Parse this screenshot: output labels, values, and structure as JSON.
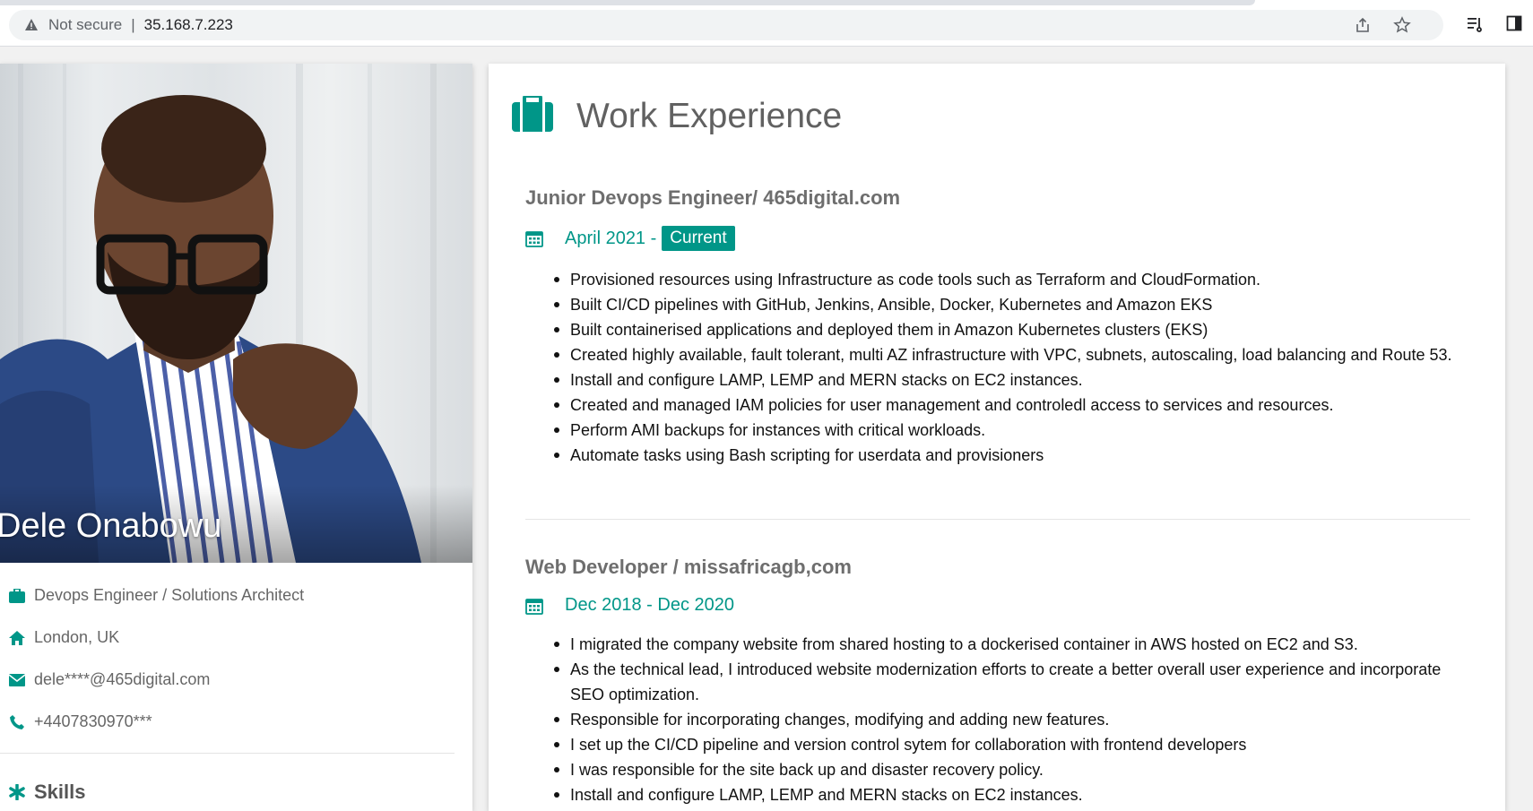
{
  "browser": {
    "security_label": "Not secure",
    "url": "35.168.7.223",
    "icons": [
      "warning-icon",
      "share-icon",
      "star-icon",
      "reading-list-icon",
      "side-panel-icon"
    ]
  },
  "profile": {
    "name": "Dele Onabowu",
    "photo_alt": "profile photo",
    "info": [
      {
        "icon": "briefcase-icon",
        "text": "Devops Engineer / Solutions Architect"
      },
      {
        "icon": "home-icon",
        "text": "London, UK"
      },
      {
        "icon": "envelope-icon",
        "text": "dele****@465digital.com"
      },
      {
        "icon": "phone-icon",
        "text": "+4407830970***"
      }
    ],
    "skills_heading": "Skills"
  },
  "work": {
    "heading": "Work Experience",
    "jobs": [
      {
        "title": "Junior Devops Engineer/ 465digital.com",
        "date": "April 2021 - ",
        "badge": "Current",
        "bullets": [
          "Provisioned resources using Infrastructure as code tools such as Terraform and CloudFormation.",
          "Built CI/CD pipelines with GitHub, Jenkins, Ansible, Docker, Kubernetes and Amazon EKS",
          "Built containerised applications and deployed them in Amazon Kubernetes clusters (EKS)",
          "Created highly available, fault tolerant, multi AZ infrastructure with VPC, subnets, autoscaling, load balancing and Route 53.",
          "Install and configure LAMP, LEMP and MERN stacks on EC2 instances.",
          "Created and managed IAM policies for user management and controledl access to services and resources.",
          "Perform AMI backups for instances with critical workloads.",
          "Automate tasks using Bash scripting for userdata and provisioners"
        ]
      },
      {
        "title": "Web Developer / missafricagb,com",
        "date": "Dec 2018 - Dec 2020",
        "bullets": [
          "I migrated the company website from shared hosting to a dockerised container in AWS hosted on EC2 and S3.",
          "As the technical lead, I introduced website modernization efforts to create a better overall user experience and incorporate SEO optimization.",
          "Responsible for incorporating changes, modifying and adding new features.",
          "I set up the CI/CD pipeline and version control sytem for collaboration with frontend developers",
          "I was responsible for the site back up and disaster recovery policy.",
          "Install and configure LAMP, LEMP and MERN stacks on EC2 instances."
        ]
      }
    ]
  },
  "colors": {
    "accent": "#009688",
    "heading": "#616161"
  }
}
